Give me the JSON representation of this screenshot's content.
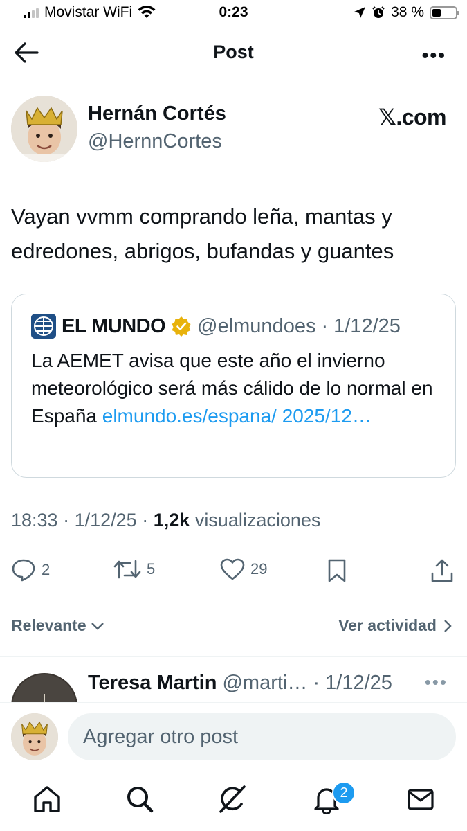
{
  "status_bar": {
    "carrier": "Movistar WiFi",
    "time": "0:23",
    "battery": "38 %",
    "battery_level": 0.38
  },
  "header": {
    "title": "Post"
  },
  "post": {
    "author_name": "Hernán Cortés",
    "author_handle": "@HernnCortes",
    "source_label": "𝕏.com",
    "text": "Vayan vvmm comprando leña, mantas y edredones, abrigos, bufandas y guantes",
    "quoted": {
      "name": "EL MUNDO",
      "handle": "@elmundoes",
      "separator": "·",
      "date": "1/12/25",
      "text": "La AEMET avisa que este año el invierno meteorológico será más cálido de lo normal en España ",
      "link": "elmundo.es/espana/ 2025/12…"
    },
    "meta": {
      "time": "18:33",
      "sep1": "·",
      "date": "1/12/25",
      "sep2": "·",
      "views_count": "1,2k",
      "views_label": "visualizaciones"
    },
    "actions": {
      "replies": "2",
      "reposts": "5",
      "likes": "29"
    }
  },
  "sorting": {
    "label": "Relevante",
    "activity_label": "Ver actividad"
  },
  "reply": {
    "name": "Teresa Martin",
    "handle": "@marti…",
    "separator": "·",
    "date": "1/12/25"
  },
  "composer": {
    "placeholder": "Agregar otro post"
  },
  "tabbar": {
    "notifications_badge": "2"
  },
  "colors": {
    "accent": "#1d9bf0",
    "text": "#0f1419",
    "secondary": "#536471",
    "border": "#cfd9de",
    "verified": "#e8b20c"
  }
}
